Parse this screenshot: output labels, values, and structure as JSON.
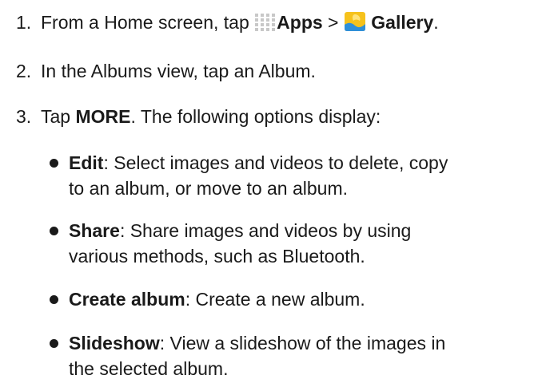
{
  "steps": [
    {
      "num": "1.",
      "pre": "From a Home screen, tap ",
      "apps_icon": "apps-grid-icon",
      "apps": "Apps",
      "sep": " > ",
      "gallery_icon": "gallery-icon",
      "gallery": "Gallery",
      "post": "."
    },
    {
      "num": "2.",
      "text": "In the Albums view, tap an Album."
    },
    {
      "num": "3.",
      "pre": "Tap ",
      "bold": "MORE",
      "post": ". The following options display:"
    }
  ],
  "options": [
    {
      "term": "Edit",
      "line1": ": Select images and videos to delete, copy",
      "line2": "to an album, or move to an album."
    },
    {
      "term": "Share",
      "line1": ": Share images and videos by using",
      "line2": "various methods, such as Bluetooth."
    },
    {
      "term": "Create album",
      "line1": ": Create a new album.",
      "line2": ""
    },
    {
      "term": "Slideshow",
      "line1": ": View a slideshow of the images in",
      "line2": "the selected album."
    }
  ],
  "colors": {
    "text": "#1a1a1a",
    "apps_icon": "#c8c8c8",
    "gallery_yellow": "#f6c21c",
    "gallery_blue": "#2f8fd8"
  }
}
